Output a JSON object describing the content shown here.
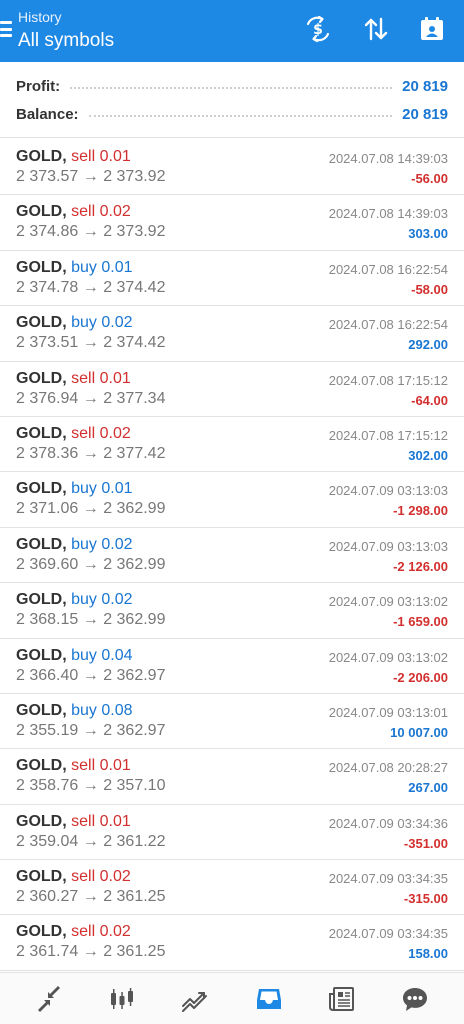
{
  "header": {
    "subtitle": "History",
    "title": "All symbols",
    "actions": [
      "currency-exchange-icon",
      "sort-icon",
      "calendar-icon"
    ]
  },
  "summary": {
    "profit_label": "Profit:",
    "profit_value": "20 819",
    "balance_label": "Balance:",
    "balance_value": "20 819"
  },
  "deals": [
    {
      "symbol": "GOLD,",
      "side": "sell",
      "volume": "0.01",
      "open": "2 373.57",
      "close": "2 373.92",
      "time": "2024.07.08 14:39:03",
      "profit": "-56.00"
    },
    {
      "symbol": "GOLD,",
      "side": "sell",
      "volume": "0.02",
      "open": "2 374.86",
      "close": "2 373.92",
      "time": "2024.07.08 14:39:03",
      "profit": "303.00"
    },
    {
      "symbol": "GOLD,",
      "side": "buy",
      "volume": "0.01",
      "open": "2 374.78",
      "close": "2 374.42",
      "time": "2024.07.08 16:22:54",
      "profit": "-58.00"
    },
    {
      "symbol": "GOLD,",
      "side": "buy",
      "volume": "0.02",
      "open": "2 373.51",
      "close": "2 374.42",
      "time": "2024.07.08 16:22:54",
      "profit": "292.00"
    },
    {
      "symbol": "GOLD,",
      "side": "sell",
      "volume": "0.01",
      "open": "2 376.94",
      "close": "2 377.34",
      "time": "2024.07.08 17:15:12",
      "profit": "-64.00"
    },
    {
      "symbol": "GOLD,",
      "side": "sell",
      "volume": "0.02",
      "open": "2 378.36",
      "close": "2 377.42",
      "time": "2024.07.08 17:15:12",
      "profit": "302.00"
    },
    {
      "symbol": "GOLD,",
      "side": "buy",
      "volume": "0.01",
      "open": "2 371.06",
      "close": "2 362.99",
      "time": "2024.07.09 03:13:03",
      "profit": "-1 298.00"
    },
    {
      "symbol": "GOLD,",
      "side": "buy",
      "volume": "0.02",
      "open": "2 369.60",
      "close": "2 362.99",
      "time": "2024.07.09 03:13:03",
      "profit": "-2 126.00"
    },
    {
      "symbol": "GOLD,",
      "side": "buy",
      "volume": "0.02",
      "open": "2 368.15",
      "close": "2 362.99",
      "time": "2024.07.09 03:13:02",
      "profit": "-1 659.00"
    },
    {
      "symbol": "GOLD,",
      "side": "buy",
      "volume": "0.04",
      "open": "2 366.40",
      "close": "2 362.97",
      "time": "2024.07.09 03:13:02",
      "profit": "-2 206.00"
    },
    {
      "symbol": "GOLD,",
      "side": "buy",
      "volume": "0.08",
      "open": "2 355.19",
      "close": "2 362.97",
      "time": "2024.07.09 03:13:01",
      "profit": "10 007.00"
    },
    {
      "symbol": "GOLD,",
      "side": "sell",
      "volume": "0.01",
      "open": "2 358.76",
      "close": "2 357.10",
      "time": "2024.07.08 20:28:27",
      "profit": "267.00"
    },
    {
      "symbol": "GOLD,",
      "side": "sell",
      "volume": "0.01",
      "open": "2 359.04",
      "close": "2 361.22",
      "time": "2024.07.09 03:34:36",
      "profit": "-351.00"
    },
    {
      "symbol": "GOLD,",
      "side": "sell",
      "volume": "0.02",
      "open": "2 360.27",
      "close": "2 361.25",
      "time": "2024.07.09 03:34:35",
      "profit": "-315.00"
    },
    {
      "symbol": "GOLD,",
      "side": "sell",
      "volume": "0.02",
      "open": "2 361.74",
      "close": "2 361.25",
      "time": "2024.07.09 03:34:35",
      "profit": "158.00"
    }
  ],
  "bottom_nav": [
    {
      "icon": "quotes-icon",
      "active": false
    },
    {
      "icon": "chart-icon",
      "active": false
    },
    {
      "icon": "trade-icon",
      "active": false
    },
    {
      "icon": "history-icon",
      "active": true
    },
    {
      "icon": "news-icon",
      "active": false
    },
    {
      "icon": "messages-icon",
      "active": false
    }
  ],
  "colors": {
    "header_bg": "#1e88e5",
    "sell": "#d32f2f",
    "buy": "#1976d2",
    "profit_negative": "#d32f2f",
    "profit_positive": "#1976d2",
    "nav_active": "#1e88e5",
    "nav_inactive": "#555555"
  }
}
